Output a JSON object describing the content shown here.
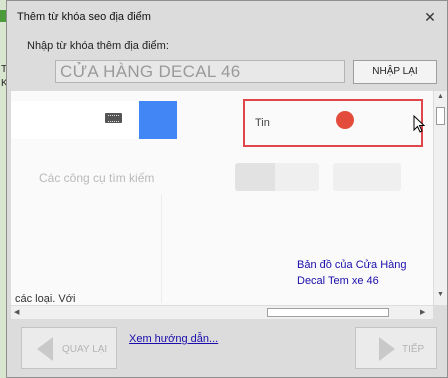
{
  "background_app": {
    "row_letters": [
      "T",
      "K"
    ]
  },
  "dialog": {
    "title": "Thêm từ khóa seo địa điểm",
    "close_glyph": "✕",
    "prompt_label": "Nhập từ khóa thêm địa điểm:",
    "keyword_value": "CỬA HÀNG DECAL 46",
    "reenter_label": "NHẬP LẠI"
  },
  "browser": {
    "tools_label": "Các công cụ tìm kiếm",
    "tin_label": "Tin",
    "map_link": "Bản đồ của Cửa Hàng Decal Tem xe 46",
    "bottom_text": "các loại. Với"
  },
  "footer": {
    "back_label": "QUAY LẠI",
    "guide_link": "Xem hướng dẫn...",
    "next_label": "TIẾP"
  },
  "colors": {
    "highlight": "#e0474c",
    "red_dot": "#e34c3a",
    "search_blue": "#4285f4",
    "link": "#1a0dab"
  }
}
